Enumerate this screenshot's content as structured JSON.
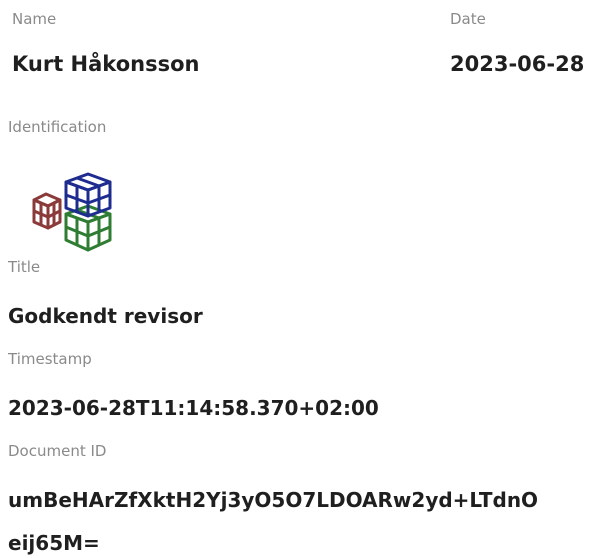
{
  "fields": {
    "name": {
      "label": "Name",
      "value": "Kurt Håkonsson"
    },
    "date": {
      "label": "Date",
      "value": "2023-06-28"
    },
    "identification": {
      "label": "Identification",
      "icon": "cubes-icon"
    },
    "title": {
      "label": "Title",
      "value": "Godkendt revisor"
    },
    "timestamp": {
      "label": "Timestamp",
      "value": "2023-06-28T11:14:58.370+02:00"
    },
    "document_id": {
      "label": "Document ID",
      "value_line1": "umBeHArZfXktH2Yj3yO5O7LDOARw2yd+LTdnO",
      "value_line2": "eij65M="
    }
  },
  "colors": {
    "label": "#8a8a8a",
    "value": "#1f1f1f",
    "cube_red": "#8b3a3a",
    "cube_blue": "#1e2b8f",
    "cube_green": "#2e7d32"
  }
}
